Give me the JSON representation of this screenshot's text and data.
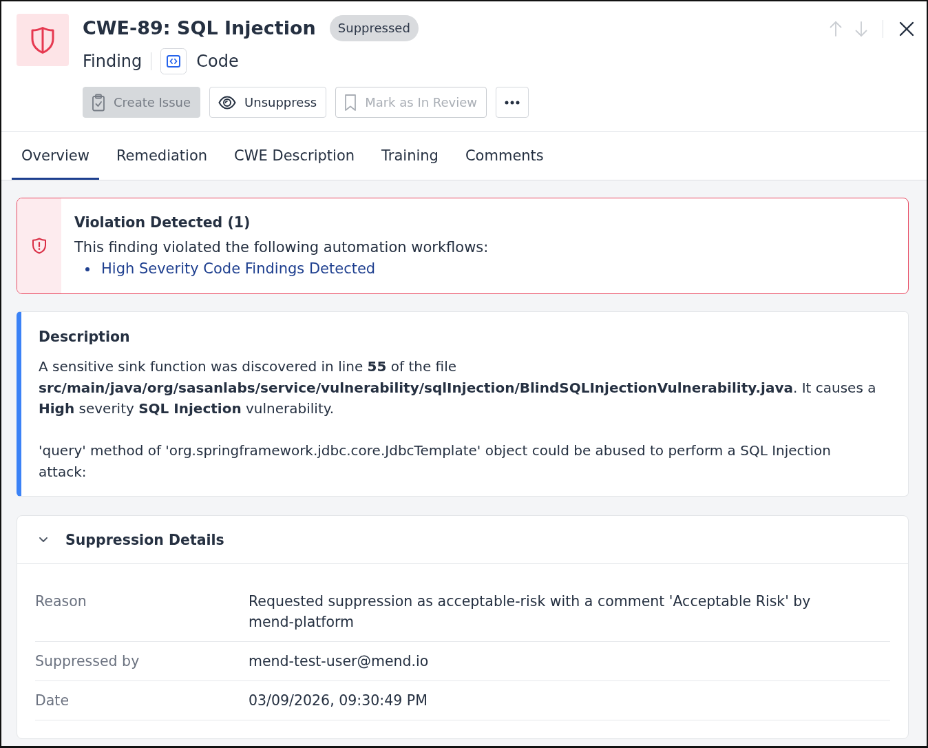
{
  "header": {
    "title": "CWE-89: SQL Injection",
    "status_badge": "Suppressed",
    "type_label": "Finding",
    "category": "Code"
  },
  "actions": [
    {
      "kind": "create-issue",
      "label": "Create Issue",
      "disabled": true
    },
    {
      "kind": "unsuppress",
      "label": "Unsuppress",
      "disabled": false
    },
    {
      "kind": "review",
      "label": "Mark as In Review",
      "disabled": true
    },
    {
      "kind": "more",
      "disabled": false
    }
  ],
  "nav_buttons": [
    {
      "kind": "up",
      "disabled": true
    },
    {
      "kind": "down",
      "disabled": true
    }
  ],
  "tabs": [
    {
      "label": "Overview",
      "selected": true
    },
    {
      "label": "Remediation",
      "selected": false
    },
    {
      "label": "CWE Description",
      "selected": false
    },
    {
      "label": "Training",
      "selected": false
    },
    {
      "label": "Comments",
      "selected": false
    }
  ],
  "violation": {
    "title": "Violation Detected (1)",
    "text": "This finding violated the following automation workflows:",
    "workflows": [
      "High Severity Code Findings Detected"
    ]
  },
  "description": {
    "title": "Description",
    "paragraphs": [
      "A sensitive sink function was discovered in line **55** of the file **src/main/java/org/sasanlabs/service/vulnerability/sqlInjection/BlindSQLInjectionVulnerability.java**. It causes a **High** severity **SQL Injection** vulnerability.",
      "'query' method of 'org.springframework.jdbc.core.JdbcTemplate' object could be abused to perform a SQL Injection attack:"
    ]
  },
  "suppression": {
    "title": "Suppression Details",
    "expanded": true,
    "rows": [
      {
        "label": "Reason",
        "value": "Requested suppression as acceptable-risk with a comment 'Acceptable Risk' by mend-platform"
      },
      {
        "label": "Suppressed by",
        "value": "mend-test-user@mend.io"
      },
      {
        "label": "Date",
        "value": "03/09/2026, 09:30:49 PM"
      }
    ]
  }
}
